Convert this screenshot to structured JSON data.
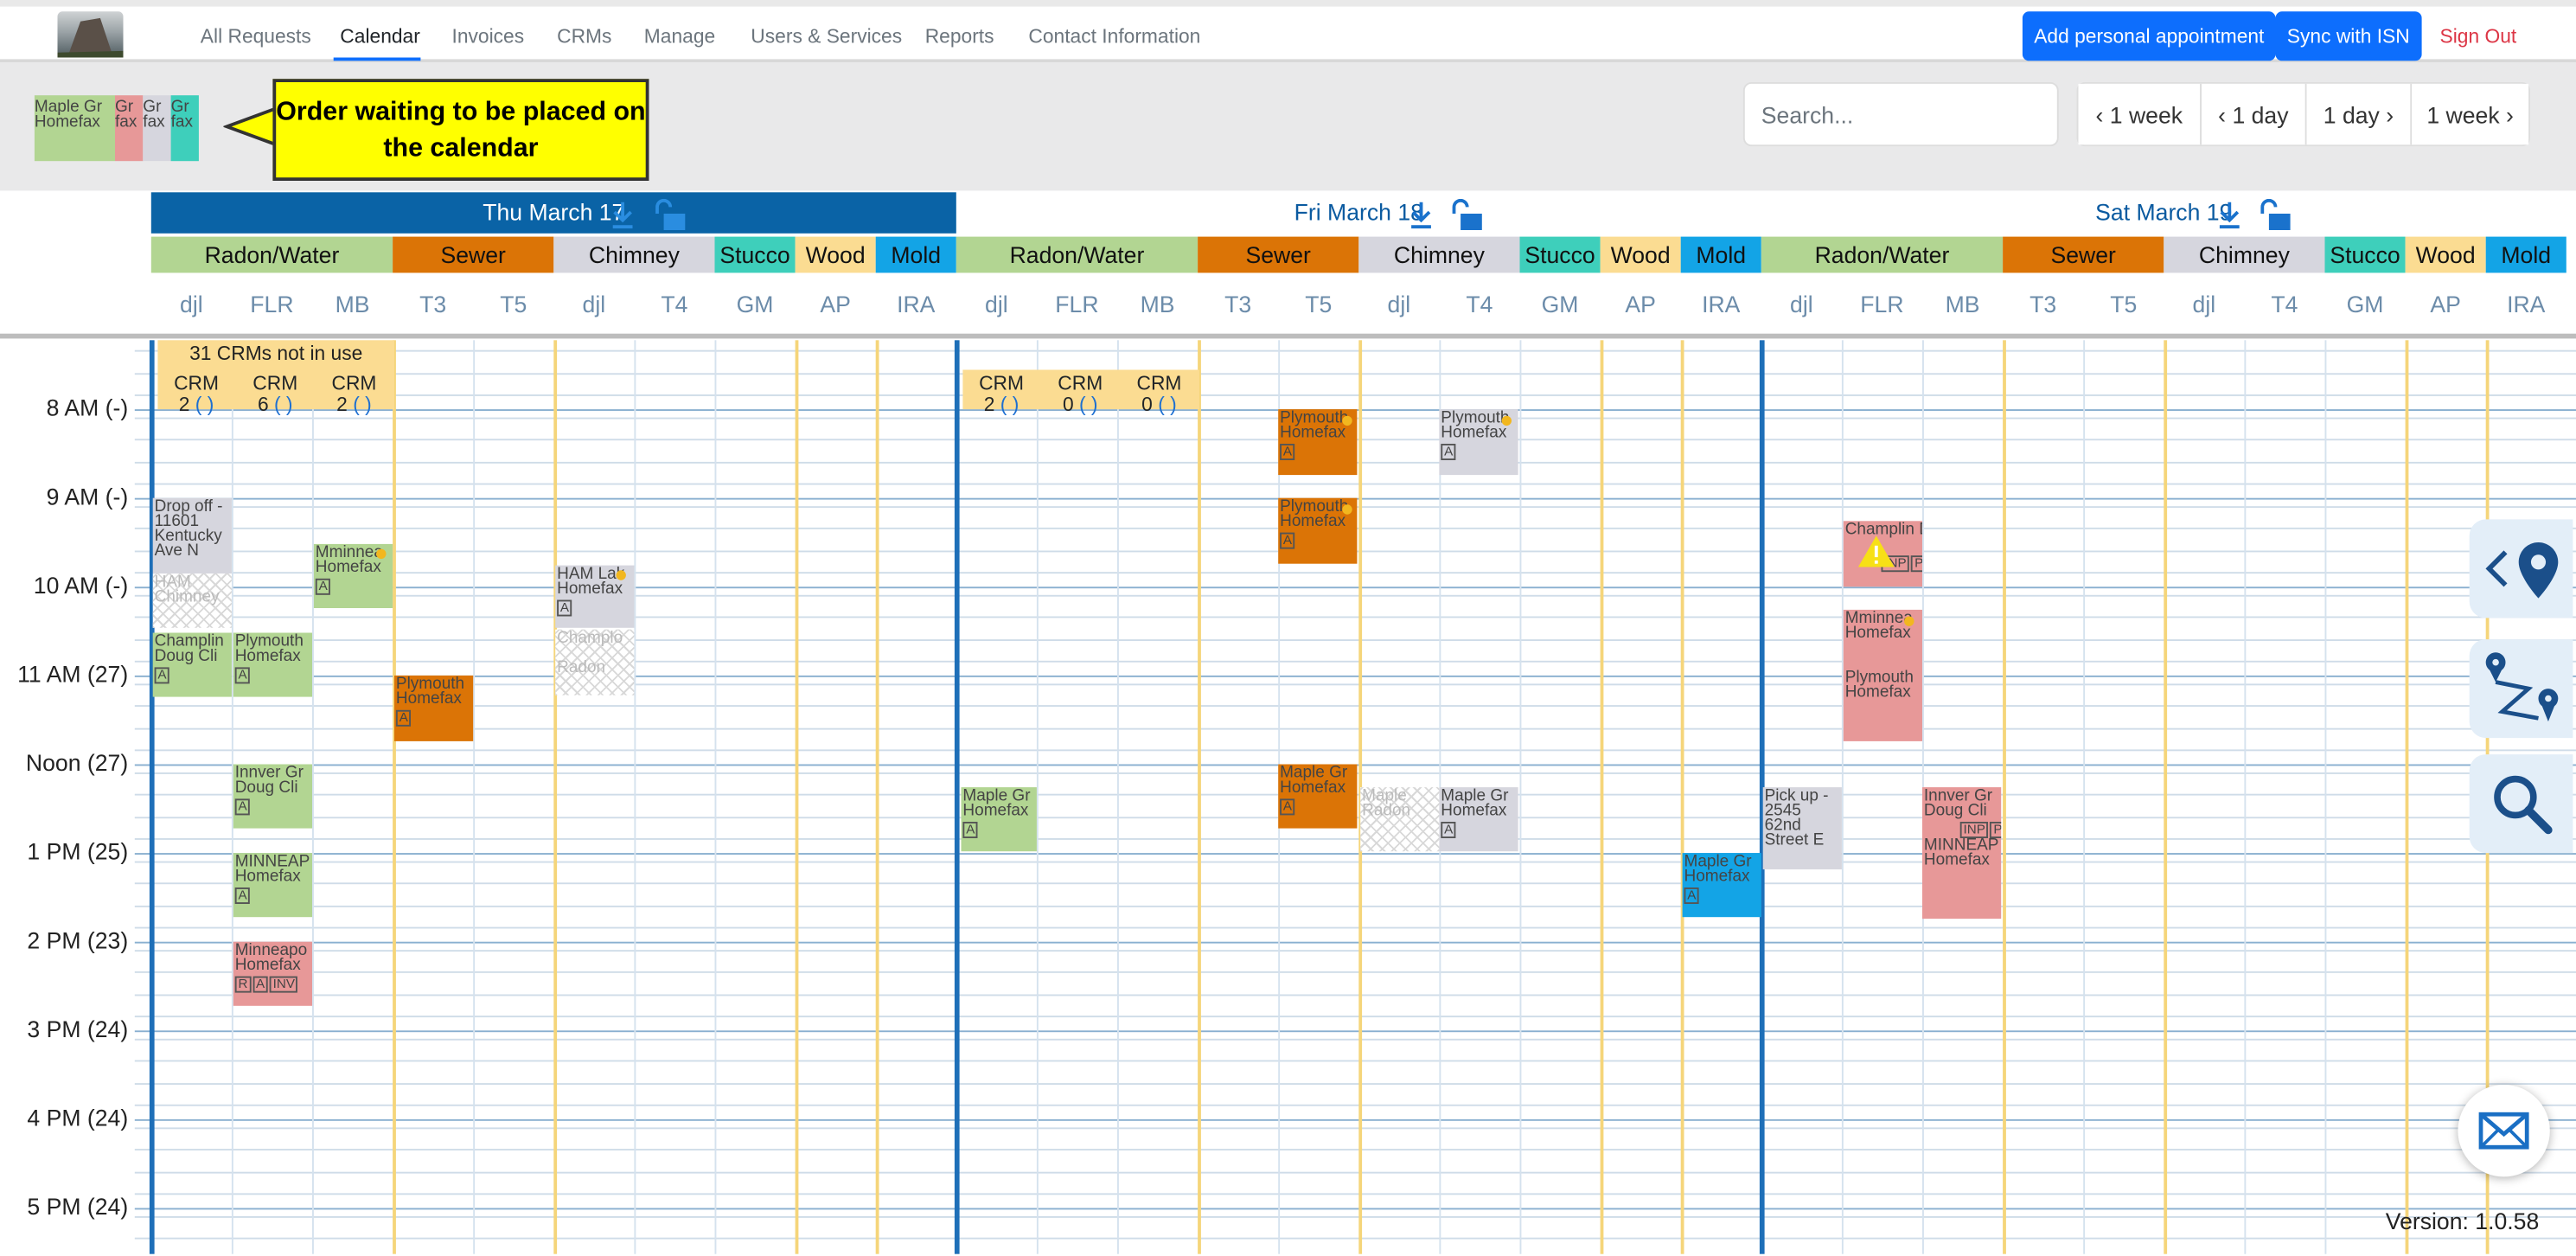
{
  "nav": {
    "links": [
      "All Requests",
      "Calendar",
      "Invoices",
      "CRMs",
      "Manage",
      "Users & Services",
      "Reports",
      "Contact Information"
    ],
    "active": "Calendar",
    "add_appointment": "Add personal appointment",
    "sync": "Sync with ISN",
    "signout": "Sign Out"
  },
  "pending": {
    "orders": [
      "Maple Gr",
      "Homefax",
      "Gr",
      "fax",
      "Gr",
      "fax",
      "Gr",
      "fax"
    ],
    "callout": "Order waiting to be placed on the calendar"
  },
  "search": {
    "placeholder": "Search..."
  },
  "range": {
    "back_week": "1 week",
    "back_day": "1 day",
    "fwd_day": "1 day",
    "fwd_week": "1 week"
  },
  "days": [
    "Thu March 17",
    "Fri March 18",
    "Sat March 19"
  ],
  "categories": [
    "Radon/Water",
    "Sewer",
    "Chimney",
    "Stucco",
    "Wood",
    "Mold"
  ],
  "columns": [
    "djl",
    "FLR",
    "MB",
    "T3",
    "T5",
    "djl",
    "T4",
    "GM",
    "AP",
    "IRA"
  ],
  "times": [
    "8 AM (-)",
    "9 AM (-)",
    "10 AM (-)",
    "11 AM (27)",
    "Noon (27)",
    "1 PM (25)",
    "2 PM (23)",
    "3 PM (24)",
    "4 PM (24)",
    "5 PM (24)"
  ],
  "crm": {
    "not_in_use": "31 CRMs not in use",
    "label": "CRM",
    "paren": "( )",
    "thu_counts": [
      "2",
      "6",
      "2"
    ],
    "fri_counts": [
      "2",
      "0",
      "0"
    ]
  },
  "events": {
    "drop_off": "Drop off - 11601 Kentucky Ave N",
    "ham_chimney": "HAM Chimney",
    "mminn": "Mminnea",
    "homefax": "Homefax",
    "champlin": "Champlin",
    "doug": "Doug Cli",
    "plymouth": "Plymouth",
    "innver": "Innver Gr",
    "minneap_caps": "MINNEAP",
    "minneapo": "Minneapo",
    "ham_lak": "HAM Lak",
    "champlo": "Champlo",
    "radon": "Radon",
    "maple": "Maple Gr",
    "maple_radon": "Maple Radon",
    "pickup": "Pick up - 2545 62nd Street E",
    "champlin_doug": "Champlin Doug Clie",
    "tag_a": "A",
    "tag_r": "R",
    "tag_inv": "INV",
    "tag_inp": "INP",
    "tag_p": "P"
  },
  "version": "Version: 1.0.58",
  "colors": {
    "radon": "#b2d592",
    "sewer": "#db7406",
    "chimney": "#d6d6de",
    "stucco": "#3ecfbb",
    "wood": "#fbdc92",
    "mold": "#13a4e6",
    "red": "#e79898",
    "blue": "#0a63a6"
  }
}
